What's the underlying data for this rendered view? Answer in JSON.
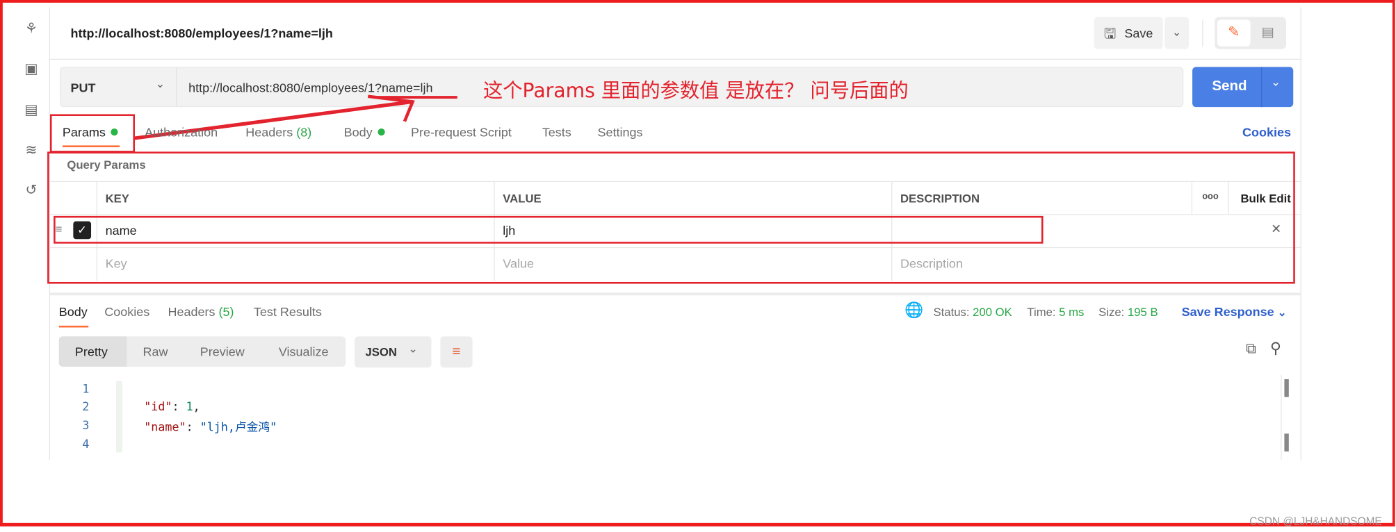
{
  "sidebar": {
    "icons": [
      "collections-icon",
      "apis-icon",
      "environments-icon",
      "monitors-icon",
      "history-icon"
    ]
  },
  "header": {
    "title": "http://localhost:8080/employees/1?name=ljh",
    "save_label": "Save"
  },
  "request": {
    "method": "PUT",
    "url": "http://localhost:8080/employees/1?name=ljh",
    "send_label": "Send"
  },
  "annotation": {
    "text": "这个Params 里面的参数值 是放在？ 问号后面的",
    "color": "#e3232d"
  },
  "request_tabs": {
    "items": [
      {
        "label": "Params",
        "dot": true
      },
      {
        "label": "Authorization"
      },
      {
        "label": "Headers",
        "count": "(8)"
      },
      {
        "label": "Body",
        "dot": true
      },
      {
        "label": "Pre-request Script"
      },
      {
        "label": "Tests"
      },
      {
        "label": "Settings"
      }
    ],
    "active": "Params",
    "cookies_label": "Cookies"
  },
  "params": {
    "section_title": "Query Params",
    "columns": [
      "KEY",
      "VALUE",
      "DESCRIPTION"
    ],
    "more_label": "ooo",
    "bulk_edit_label": "Bulk Edit",
    "rows": [
      {
        "checked": true,
        "key": "name",
        "value": "ljh",
        "description": ""
      }
    ],
    "placeholders": {
      "key": "Key",
      "value": "Value",
      "description": "Description"
    }
  },
  "response": {
    "tabs": [
      {
        "label": "Body"
      },
      {
        "label": "Cookies"
      },
      {
        "label": "Headers",
        "count": "(5)"
      },
      {
        "label": "Test Results"
      }
    ],
    "active": "Body",
    "status_label": "Status:",
    "status_value": "200 OK",
    "time_label": "Time:",
    "time_value": "5 ms",
    "size_label": "Size:",
    "size_value": "195 B",
    "save_response_label": "Save Response",
    "view_modes": [
      "Pretty",
      "Raw",
      "Preview",
      "Visualize"
    ],
    "active_view": "Pretty",
    "format": "JSON",
    "code_lines": [
      {
        "n": "1",
        "parts": [
          [
            "{",
            "#212121"
          ]
        ]
      },
      {
        "n": "2",
        "parts": [
          [
            "    ",
            "#212121"
          ],
          [
            "\"id\"",
            "#a31515"
          ],
          [
            ": ",
            "#212121"
          ],
          [
            "1",
            "#098658"
          ],
          [
            ",",
            "#212121"
          ]
        ]
      },
      {
        "n": "3",
        "parts": [
          [
            "    ",
            "#212121"
          ],
          [
            "\"name\"",
            "#a31515"
          ],
          [
            ": ",
            "#212121"
          ],
          [
            "\"ljh,卢金鸿\"",
            "#0451a5"
          ]
        ]
      },
      {
        "n": "4",
        "parts": [
          [
            "}",
            "#212121"
          ]
        ]
      }
    ]
  },
  "watermark": "CSDN @LJH&HANDSOME",
  "colors": {
    "accent": "#ff6c37",
    "send": "#4a7fe5",
    "link": "#2e5fcb",
    "annotation": "#e3232d"
  }
}
